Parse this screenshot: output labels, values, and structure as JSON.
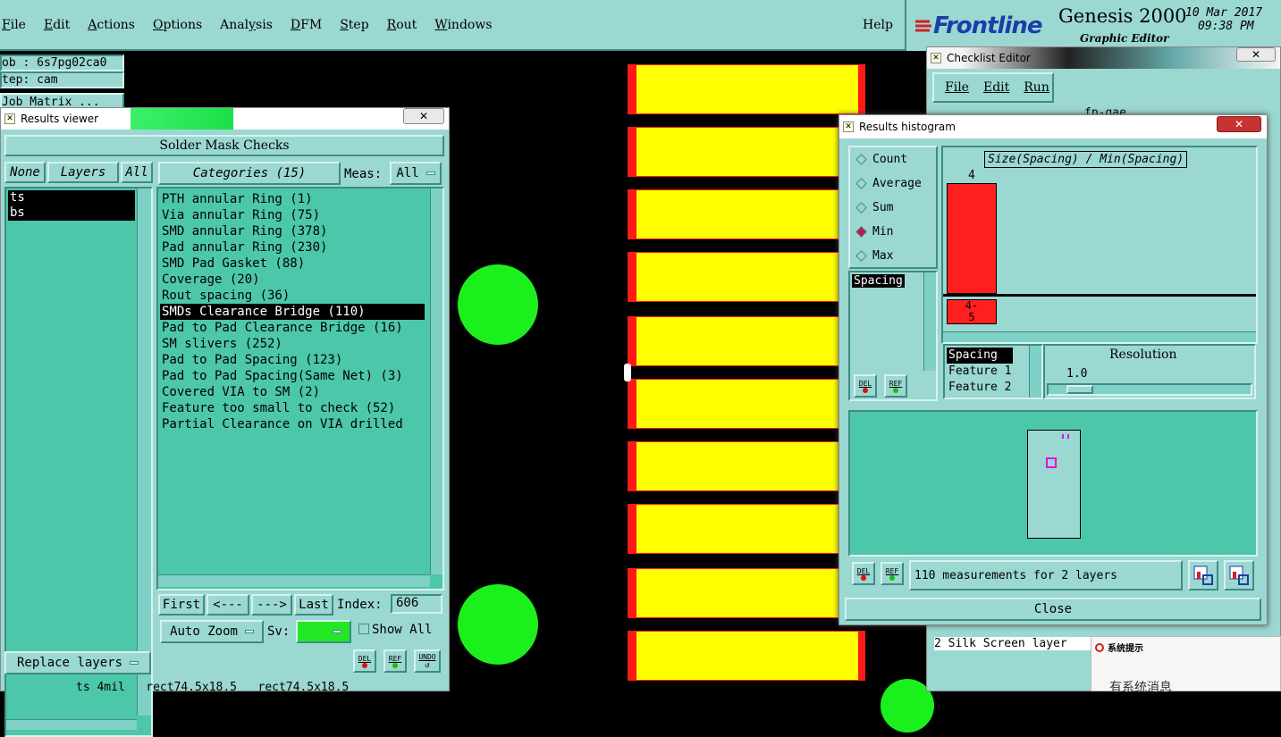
{
  "menubar": {
    "items": [
      {
        "label": "File",
        "u": "F"
      },
      {
        "label": "Edit",
        "u": "E"
      },
      {
        "label": "Actions",
        "u": "A"
      },
      {
        "label": "Options",
        "u": "O"
      },
      {
        "label": "Analysis",
        "u": "y"
      },
      {
        "label": "DFM",
        "u": "D"
      },
      {
        "label": "Step",
        "u": "S"
      },
      {
        "label": "Rout",
        "u": "R"
      },
      {
        "label": "Windows",
        "u": "W"
      }
    ],
    "help": "Help"
  },
  "brand": {
    "logo": "Frontline",
    "product": "Genesis 2000",
    "subtitle": "Graphic Editor",
    "date": "10 Mar 2017",
    "time": "09:38 PM"
  },
  "job_info": {
    "job": "ob : 6s7pg02ca0",
    "step": "tep: cam",
    "job_matrix": "Job Matrix ..."
  },
  "results_viewer": {
    "title": "Results viewer",
    "header": "Solder Mask Checks",
    "none_btn": "None",
    "layers_btn": "Layers",
    "all_btn": "All",
    "categories_btn": "Categories (15)",
    "meas_label": "Meas:",
    "meas_value": "All",
    "layers": [
      "ts",
      "bs"
    ],
    "categories": [
      "PTH annular Ring (1)",
      "Via annular Ring (75)",
      "SMD annular Ring (378)",
      "Pad annular Ring (230)",
      "SMD Pad Gasket (88)",
      "Coverage (20)",
      "Rout spacing (36)",
      "SMDs Clearance Bridge (110)",
      "Pad to Pad Clearance Bridge (16)",
      "SM slivers (252)",
      "Pad to Pad Spacing (123)",
      "Pad to Pad Spacing(Same Net) (3)",
      "Covered VIA to SM (2)",
      "Feature too small to check (52)",
      "Partial Clearance on VIA drilled"
    ],
    "selected_category_index": 7,
    "first_btn": "First",
    "prev_btn": "<---",
    "next_btn": "--->",
    "last_btn": "Last",
    "index_label": "Index:",
    "index_value": "606",
    "auto_zoom": "Auto Zoom",
    "sv_label": "Sv:",
    "show_all": "Show All",
    "replace_layers": "Replace layers",
    "del": "DEL",
    "ref": "REF",
    "undo": "UNDO",
    "status": "ts 4mil   rect74.5x18.5   rect74.5x18.5"
  },
  "checklist_editor": {
    "title": "Checklist Editor",
    "menu": [
      "File",
      "Edit",
      "Run"
    ],
    "name": "fp-gae",
    "row_text": "2 Silk Screen layer"
  },
  "histogram": {
    "title": "Results histogram",
    "modes": [
      "Count",
      "Average",
      "Sum",
      "Min",
      "Max"
    ],
    "selected_mode": "Min",
    "chart_title": "Size(Spacing) / Min(Spacing)",
    "bar_value": "4",
    "bar_range_label": "4-\n5",
    "attr_list": [
      "Spacing"
    ],
    "sort_list": [
      "Spacing",
      "Feature 1",
      "Feature 2"
    ],
    "resolution_label": "Resolution",
    "resolution_value": "1.0",
    "measurements": "110 measurements for 2 layers",
    "close": "Close",
    "del": "DEL",
    "ref": "REF"
  },
  "sys_popup": {
    "title": "系统提示",
    "body": "有系统消息"
  },
  "colors": {
    "pad_fill": "#ffff00",
    "pad_edge": "#ff1a1a",
    "via": "#1cf01c",
    "ui_teal": "#9bd8d2",
    "selected_mode": "#c4154a"
  }
}
